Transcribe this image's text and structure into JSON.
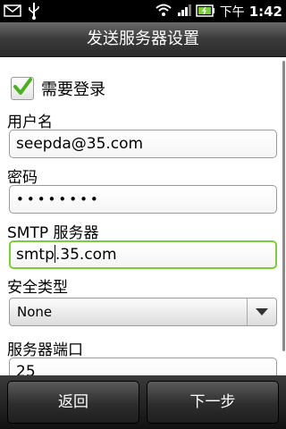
{
  "status_bar": {
    "ampm": "下午",
    "time": "1:42",
    "icons": [
      "email-icon",
      "usb-icon",
      "wifi-icon",
      "signal-icon",
      "battery-icon"
    ]
  },
  "title": "发送服务器设置",
  "form": {
    "require_login": {
      "label": "需要登录",
      "checked": true
    },
    "username": {
      "label": "用户名",
      "value": "seepda@35.com"
    },
    "password": {
      "label": "密码",
      "value": "••••••••"
    },
    "smtp_server": {
      "label": "SMTP 服务器",
      "value_before_cursor": "smtp",
      "value_after_cursor": ".35.com"
    },
    "security_type": {
      "label": "安全类型",
      "value": "None"
    },
    "server_port": {
      "label": "服务器端口",
      "value": "25"
    }
  },
  "buttons": {
    "back": "返回",
    "next": "下一步"
  },
  "colors": {
    "focus_border": "#7ccd3c",
    "check_green": "#4caf1e"
  }
}
